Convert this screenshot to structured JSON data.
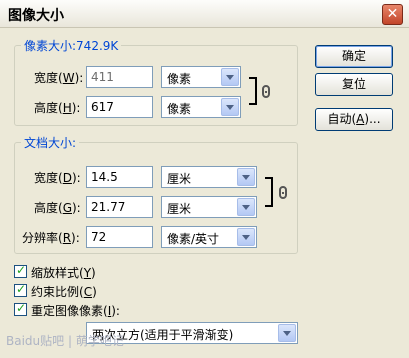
{
  "window": {
    "title": "图像大小",
    "close_label": "✕"
  },
  "pixel_dimensions": {
    "legend": "像素大小:742.9K",
    "width": {
      "label": "宽度(",
      "key": "W",
      "suffix": "):",
      "value": "411",
      "unit": "像素"
    },
    "height": {
      "label": "高度(",
      "key": "H",
      "suffix": "):",
      "value": "617",
      "unit": "像素"
    }
  },
  "document_size": {
    "legend": "文档大小:",
    "width": {
      "label": "宽度(",
      "key": "D",
      "suffix": "):",
      "value": "14.5",
      "unit": "厘米"
    },
    "height": {
      "label": "高度(",
      "key": "G",
      "suffix": "):",
      "value": "21.77",
      "unit": "厘米"
    },
    "resolution": {
      "label": "分辨率(",
      "key": "R",
      "suffix": "):",
      "value": "72",
      "unit": "像素/英寸"
    }
  },
  "buttons": {
    "ok": "确定",
    "reset": "复位",
    "auto_pre": "自动(",
    "auto_key": "A",
    "auto_post": ")..."
  },
  "options": {
    "scale_styles": {
      "pre": "缩放样式(",
      "key": "Y",
      "post": ")",
      "checked": true
    },
    "constrain": {
      "pre": "约束比例(",
      "key": "C",
      "post": ")",
      "checked": true
    },
    "resample": {
      "pre": "重定图像像素(",
      "key": "I",
      "post": "):",
      "checked": true
    },
    "resample_method": "两次立方(适用于平滑渐变)"
  },
  "watermark": "Baidu贴吧 | 萌学吧记"
}
